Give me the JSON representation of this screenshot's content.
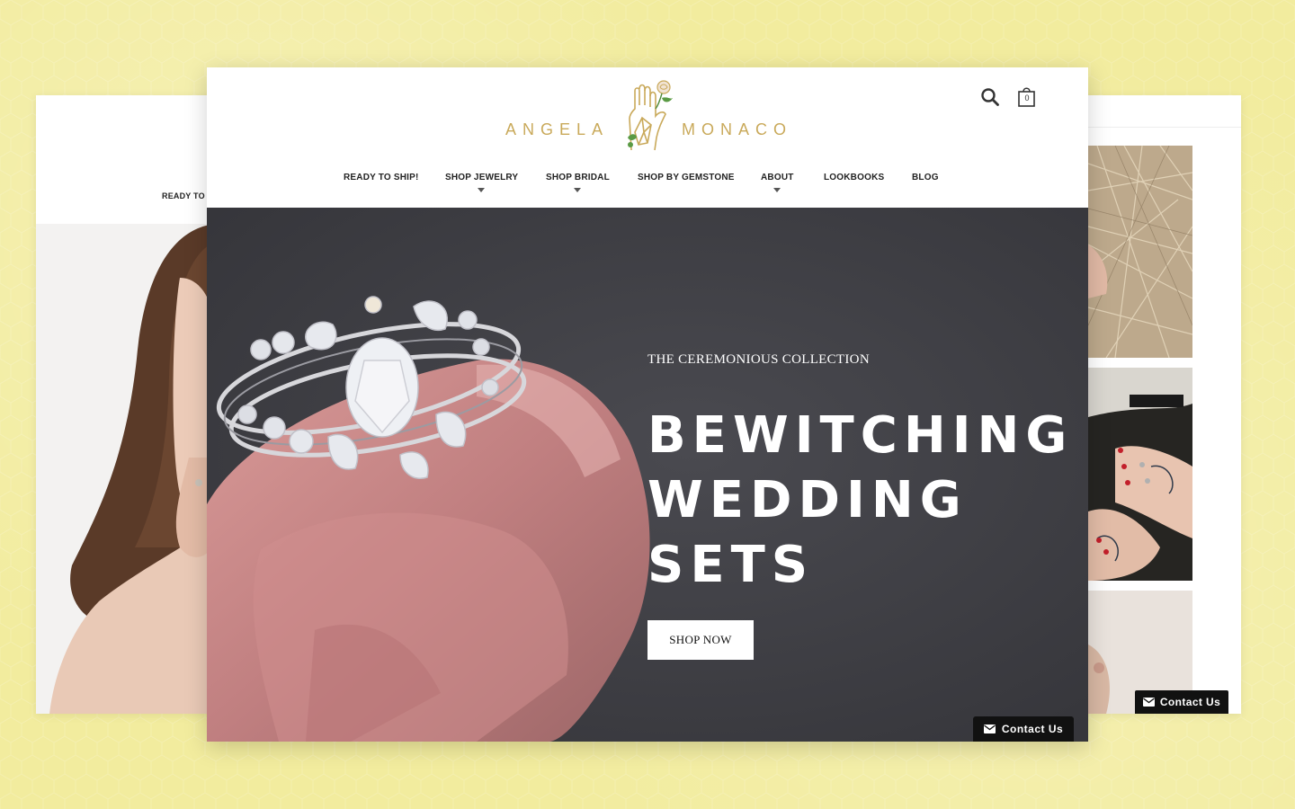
{
  "colors": {
    "background": "#f2ec9e",
    "logo_gold": "#c9a95a",
    "hero_dark": "#3d3d42",
    "rose_quartz": "#c98888"
  },
  "left_window": {
    "nav_cut_text": "READY TO S"
  },
  "brand": {
    "name_left": "ANGELA",
    "name_right": "MONACO",
    "logo_icon": "hand-crystal-rose-icon"
  },
  "header": {
    "search_icon": "search-icon",
    "cart_icon": "shopping-bag-icon",
    "cart_count": "0"
  },
  "nav": {
    "items": [
      {
        "label": "READY TO SHIP!",
        "has_dropdown": false
      },
      {
        "label": "SHOP JEWELRY",
        "has_dropdown": true
      },
      {
        "label": "SHOP BRIDAL",
        "has_dropdown": true
      },
      {
        "label": "SHOP BY GEMSTONE",
        "has_dropdown": false
      },
      {
        "label": "ABOUT",
        "has_dropdown": true
      },
      {
        "label": "LOOKBOOKS",
        "has_dropdown": false
      },
      {
        "label": "BLOG",
        "has_dropdown": false
      }
    ]
  },
  "hero": {
    "eyebrow": "THE CEREMONIOUS COLLECTION",
    "title_lines": [
      "BEWITCHING",
      "WEDDING",
      "SETS"
    ],
    "cta_label": "SHOP NOW"
  },
  "contact": {
    "label": "Contact Us",
    "icon": "envelope-icon"
  }
}
